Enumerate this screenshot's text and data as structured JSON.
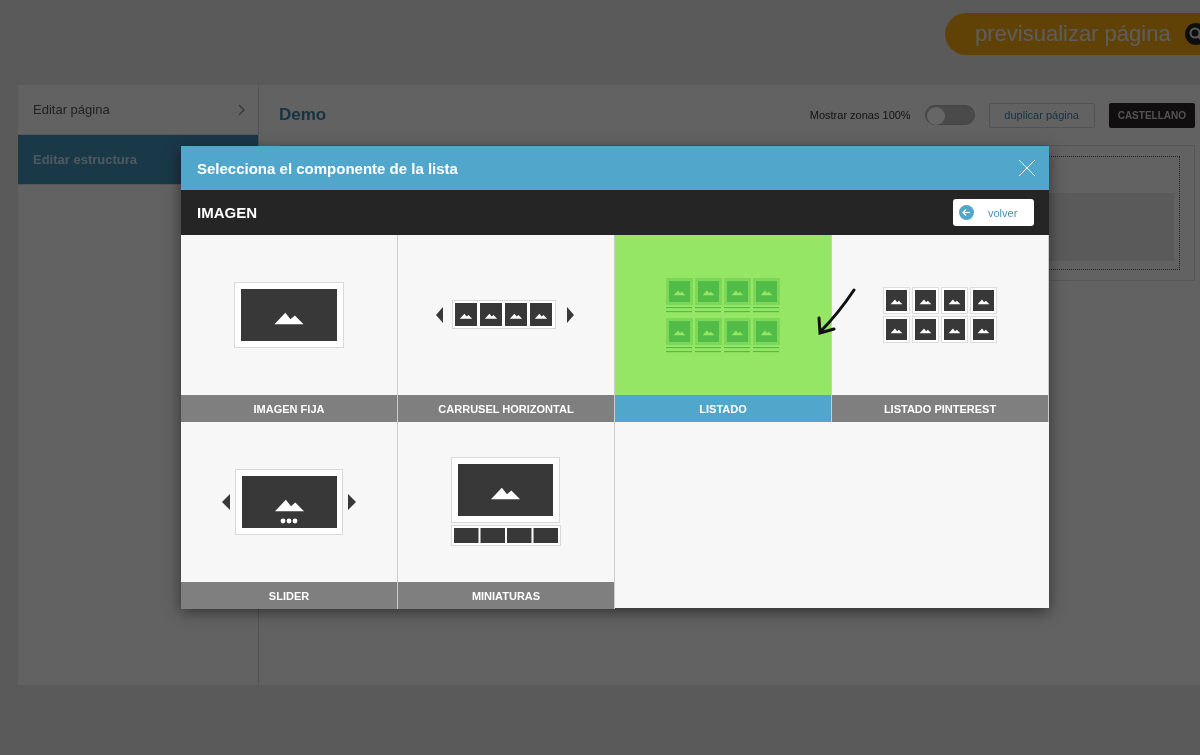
{
  "header": {
    "preview_button": "previsualizar página"
  },
  "sidebar": {
    "items": [
      {
        "label": "Editar página",
        "selected": false
      },
      {
        "label": "Editar estructura",
        "selected": true
      }
    ]
  },
  "content": {
    "title": "Demo",
    "zones_toggle": {
      "label": "Mostrar zonas 100%",
      "on": false
    },
    "duplicate_button": "duplicar página",
    "language_button": "CASTELLANO"
  },
  "modal": {
    "title": "Selecciona el componente de la lista",
    "section": "IMAGEN",
    "back_button": "volver",
    "components": [
      {
        "kind": "fixed",
        "label": "IMAGEN FIJA",
        "selected": false
      },
      {
        "kind": "carousel",
        "label": "CARRUSEL HORIZONTAL",
        "selected": false
      },
      {
        "kind": "list",
        "label": "LISTADO",
        "selected": true
      },
      {
        "kind": "pinterest",
        "label": "LISTADO PINTEREST",
        "selected": false
      },
      {
        "kind": "slider",
        "label": "SLIDER",
        "selected": false
      },
      {
        "kind": "thumbnails",
        "label": "MINIATURAS",
        "selected": false
      }
    ]
  }
}
